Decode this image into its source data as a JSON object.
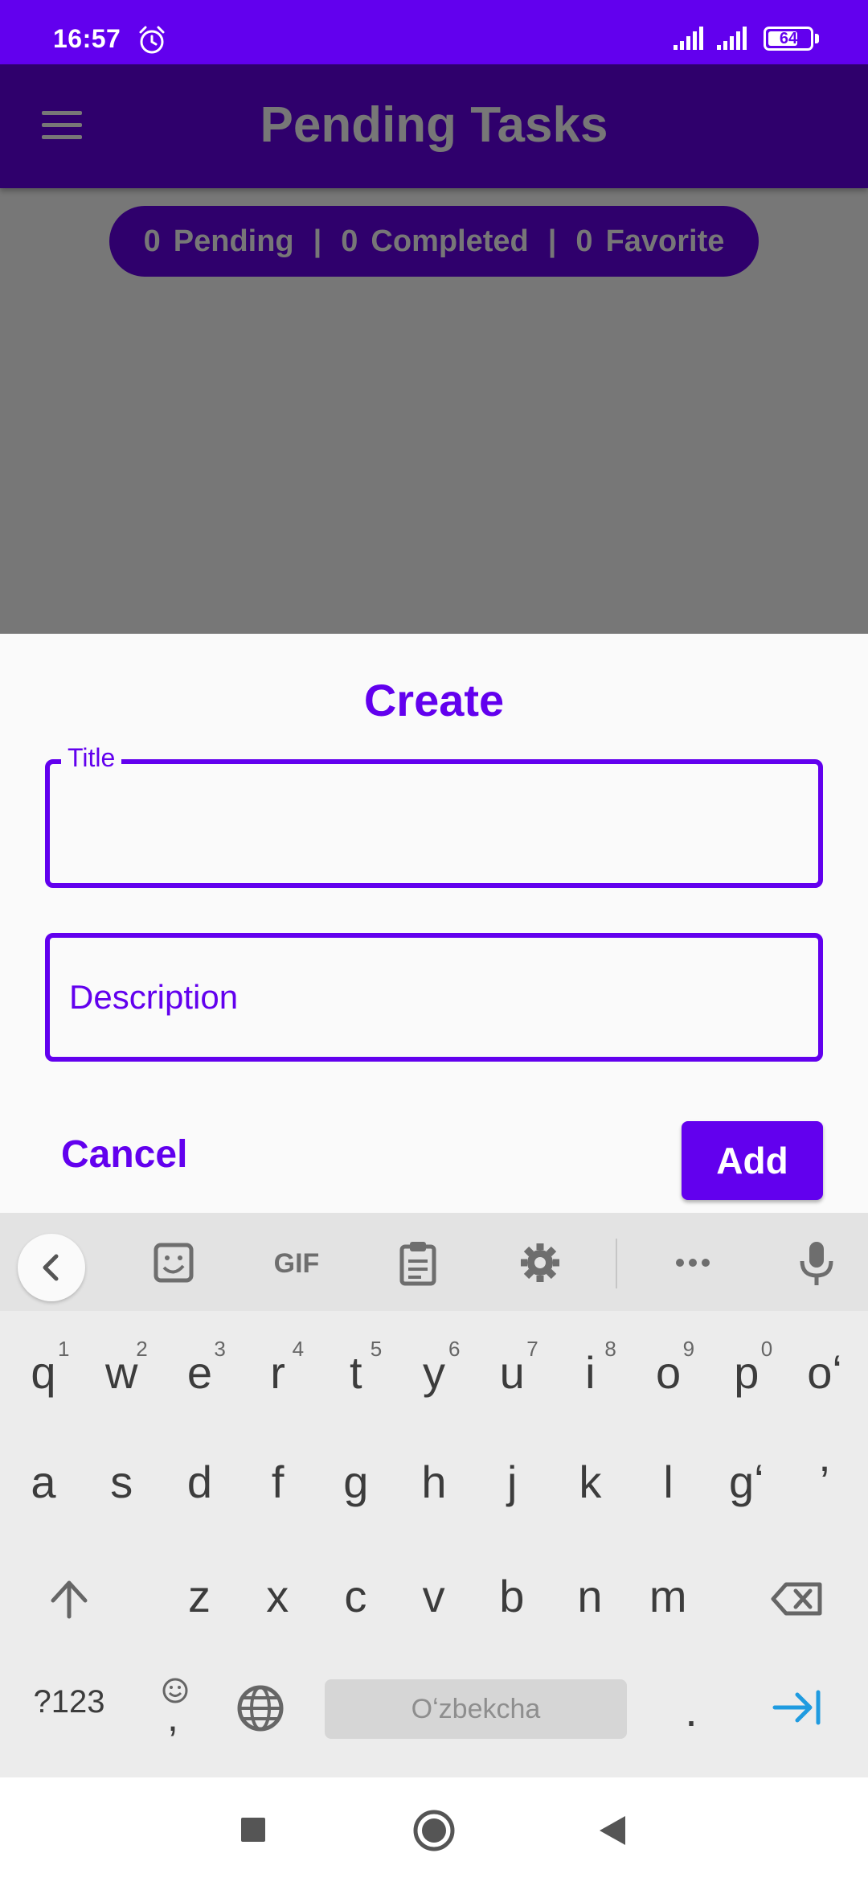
{
  "status_bar": {
    "time": "16:57",
    "battery": "64"
  },
  "app_bar": {
    "title": "Pending Tasks"
  },
  "summary": {
    "pending_count": "0",
    "pending_label": "Pending",
    "completed_count": "0",
    "completed_label": "Completed",
    "favorite_count": "0",
    "favorite_label": "Favorite",
    "separator": "|"
  },
  "dialog": {
    "title": "Create",
    "title_field_label": "Title",
    "title_field_value": "",
    "description_placeholder": "Description",
    "cancel_label": "Cancel",
    "add_label": "Add"
  },
  "keyboard": {
    "row1": [
      "q",
      "w",
      "e",
      "r",
      "t",
      "y",
      "u",
      "i",
      "o",
      "p",
      "oʻ"
    ],
    "row1_hints": [
      "1",
      "2",
      "3",
      "4",
      "5",
      "6",
      "7",
      "8",
      "9",
      "0"
    ],
    "row2": [
      "a",
      "s",
      "d",
      "f",
      "g",
      "h",
      "j",
      "k",
      "l",
      "gʻ",
      "’"
    ],
    "row3": [
      "z",
      "x",
      "c",
      "v",
      "b",
      "n",
      "m"
    ],
    "symbols_label": "?123",
    "comma_label": ",",
    "space_label": "Oʻzbekcha",
    "period_label": ".",
    "toolbar_gif": "GIF"
  }
}
